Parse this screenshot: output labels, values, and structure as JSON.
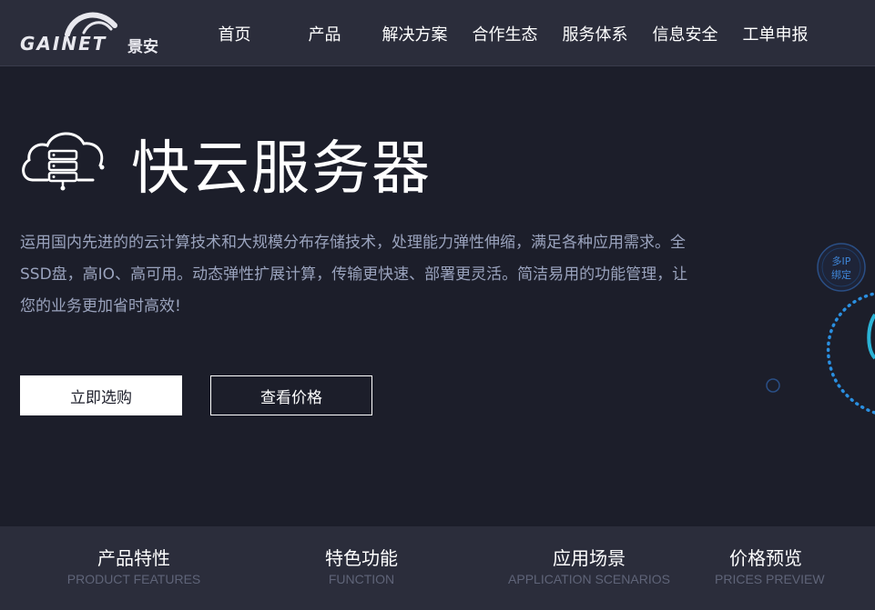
{
  "header": {
    "logo": {
      "brand": "GAINET",
      "brand_cn": "景安"
    },
    "nav": [
      {
        "label": "首页"
      },
      {
        "label": "产品"
      },
      {
        "label": "解决方案"
      },
      {
        "label": "合作生态"
      },
      {
        "label": "服务体系"
      },
      {
        "label": "信息安全"
      },
      {
        "label": "工单申报"
      }
    ]
  },
  "hero": {
    "icon": "cloud-server-icon",
    "title": "快云服务器",
    "description": "运用国内先进的的云计算技术和大规模分布存储技术，处理能力弹性伸缩，满足各种应用需求。全SSD盘，高IO、高可用。动态弹性扩展计算，传输更快速、部署更灵活。简洁易用的功能管理，让您的业务更加省时高效!",
    "buy_button": "立即选购",
    "price_button": "查看价格"
  },
  "decoration": {
    "badge_line1": "多IP",
    "badge_line2": "绑定",
    "accent_color": "#2a8fe0"
  },
  "tabs": [
    {
      "title": "产品特性",
      "subtitle": "PRODUCT FEATURES"
    },
    {
      "title": "特色功能",
      "subtitle": "FUNCTION"
    },
    {
      "title": "应用场景",
      "subtitle": "APPLICATION SCENARIOS"
    },
    {
      "title": "价格预览",
      "subtitle": "PRICES PREVIEW"
    }
  ],
  "colors": {
    "background": "#1c1e2a",
    "header_bg": "#2b2d3b",
    "description_text": "#9aa3bd",
    "subtitle_text": "#5f6478"
  }
}
